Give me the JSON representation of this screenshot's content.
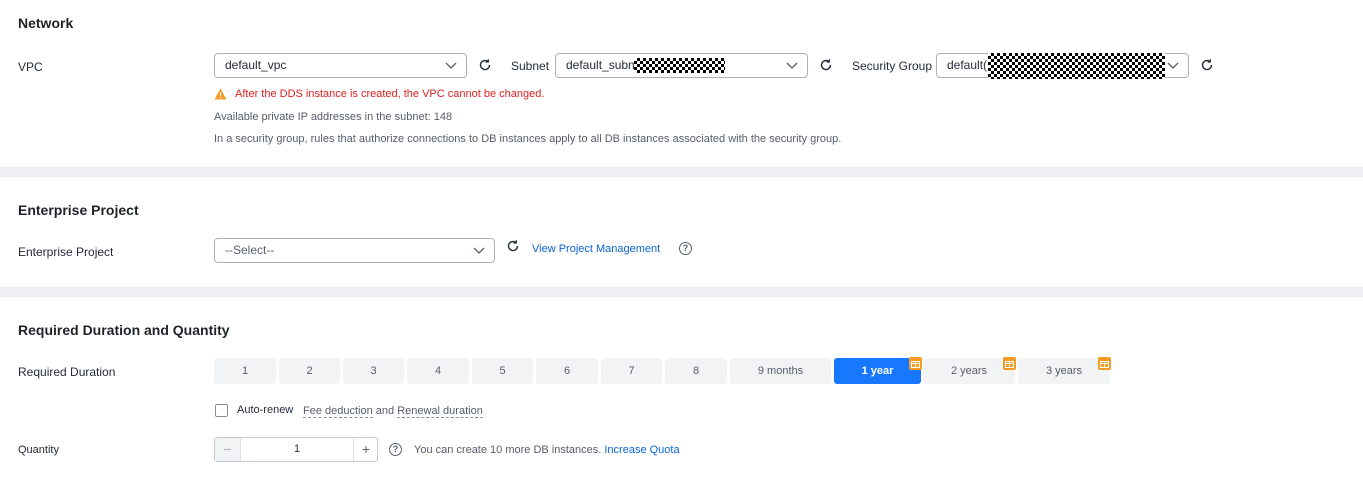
{
  "network": {
    "title": "Network",
    "vpc_label": "VPC",
    "vpc_value": "default_vpc",
    "subnet_label": "Subnet",
    "subnet_value": "default_subne",
    "security_group_label": "Security Group",
    "security_group_value": "default(",
    "warning": "After the DDS instance is created, the VPC cannot be changed.",
    "available_ips": "Available private IP addresses in the subnet: 148",
    "sg_hint": "In a security group, rules that authorize connections to DB instances apply to all DB instances associated with the security group.",
    "warning_color": "#e02020"
  },
  "enterprise": {
    "title": "Enterprise Project",
    "label": "Enterprise Project",
    "select_value": "--Select--",
    "link": "View Project Management"
  },
  "duration": {
    "title": "Required Duration and Quantity",
    "label": "Required Duration",
    "options": [
      "1",
      "2",
      "3",
      "4",
      "5",
      "6",
      "7",
      "8",
      "9 months",
      "1 year",
      "2 years",
      "3 years"
    ],
    "selected": "1 year",
    "accent_color": "#1778ff",
    "auto_renew_label": "Auto-renew",
    "fee_deduction": "Fee deduction",
    "and_text": "and",
    "renewal_duration": "Renewal duration"
  },
  "quantity": {
    "label": "Quantity",
    "value": "1",
    "minus": "−",
    "plus": "+",
    "hint": "You can create 10 more DB instances.",
    "link": "Increase Quota"
  }
}
